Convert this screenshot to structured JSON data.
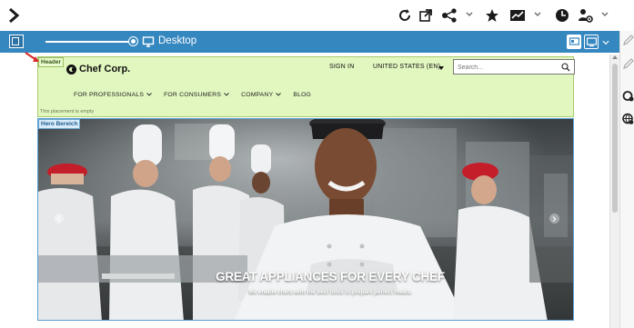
{
  "preview": {
    "device_label": "Desktop"
  },
  "site": {
    "brand_name": "Chef Corp.",
    "sign_in": "SIGN IN",
    "region": "UNITED STATES (EN)",
    "search_placeholder": "Search...",
    "nav": [
      {
        "label": "FOR PROFESSIONALS"
      },
      {
        "label": "FOR CONSUMERS"
      },
      {
        "label": "COMPANY"
      },
      {
        "label": "BLOG"
      }
    ]
  },
  "placements": {
    "header_tag": "Header",
    "header_empty_note": "This placement is empty",
    "hero_tag": "Hero Bereich"
  },
  "hero": {
    "title": "GREAT APPLIANCES FOR EVERY CHEF",
    "subtitle": "We enable chefs with the best tools to prepare perfect meals."
  },
  "colors": {
    "preview_bar": "#3587c0",
    "header_zone": "#e2f7c0",
    "hero_border": "#5aa0d6",
    "annotation_arrow": "#d9282a"
  },
  "icons": {
    "toolbar": [
      "expand-icon",
      "refresh-icon",
      "open-external-icon",
      "share-icon",
      "star-icon",
      "analytics-icon",
      "timer-icon",
      "user-settings-icon"
    ],
    "rail": [
      "pencil-icon",
      "pencil-icon",
      "reload-settings-icon",
      "globe-settings-icon"
    ]
  }
}
